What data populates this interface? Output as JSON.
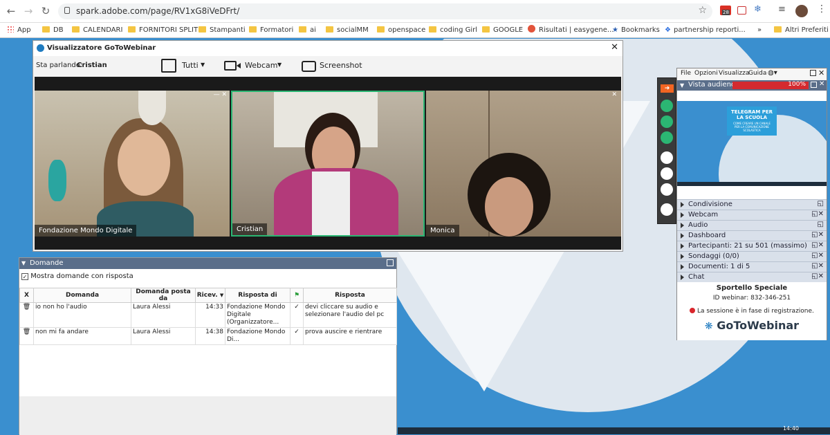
{
  "browser": {
    "url": "spark.adobe.com/page/RV1xG8iVeDFrt/",
    "badge": "28"
  },
  "bookmarks": [
    "App",
    "DB",
    "CALENDARI",
    "FORNITORI SPLIT",
    "Stampanti",
    "Formatori",
    "ai",
    "socialMM",
    "openspace",
    "coding Girl",
    "GOOGLE",
    "Risultati | easygene...",
    "Bookmarks",
    "partnership reporti...",
    "»",
    "Altri Preferiti"
  ],
  "viewer": {
    "title": "Visualizzatore GoToWebinar",
    "speaking_label": "Sta parlando:",
    "speaking_name": "Cristian",
    "tutti": "Tutti",
    "webcam": "Webcam",
    "screenshot": "Screenshot",
    "cams": [
      "Fondazione Mondo Digitale",
      "Cristian",
      "Monica"
    ]
  },
  "questions": {
    "title": "Domande",
    "show_answered": "Mostra domande con risposta",
    "columns": [
      "X",
      "Domanda",
      "Domanda posta da",
      "Ricev.",
      "Risposta di",
      "",
      "Risposta"
    ],
    "rows": [
      {
        "q": "io non ho l'audio",
        "by": "Laura Alessi",
        "time": "14:33",
        "answerer": "Fondazione Mondo Digitale (Organizzatore...",
        "answer": "devi cliccare su audio e selezionare l'audio del pc"
      },
      {
        "q": "non mi fa andare",
        "by": "Laura Alessi",
        "time": "14:38",
        "answerer": "Fondazione Mondo Di...",
        "answer": "prova auscire e rientrare"
      }
    ]
  },
  "panel": {
    "menu": [
      "File",
      "Opzioni",
      "Visualizza",
      "Guida"
    ],
    "audience": "Vista audience",
    "audience_pct": "100%",
    "slide_title": "TELEGRAM PER LA SCUOLA",
    "slide_sub": "COME CREARE UN CANALE PER LA COMUNICAZIONE SCOLASTICA",
    "sections": [
      "Condivisione",
      "Webcam",
      "Audio",
      "Dashboard",
      "Partecipanti:  21 su 501 (massimo)",
      "Sondaggi (0/0)",
      "Documenti: 1 di 5",
      "Chat"
    ],
    "webinar_name": "Sportello Speciale",
    "webinar_id": "ID webinar: 832-346-251",
    "rec_status": "La sessione è in fase di registrazione.",
    "brand": "GoToWebinar"
  },
  "taskbar": {
    "clock": "14:40"
  },
  "colors": {
    "accent": "#3a8fcf",
    "speaker_border": "#2bb673",
    "rec": "#d9262c"
  }
}
